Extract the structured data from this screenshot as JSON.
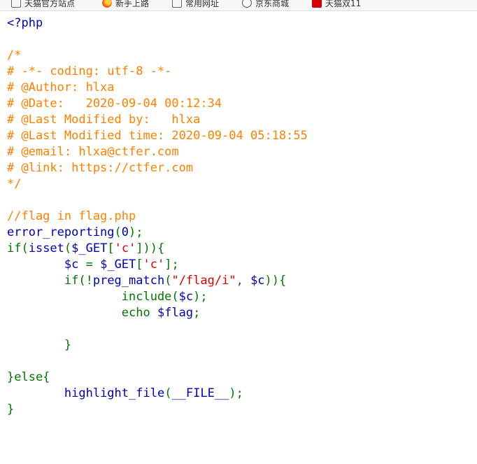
{
  "bookmarks": [
    {
      "icon": "folder-icon",
      "label": "天猫官方站点"
    },
    {
      "icon": "firefox-icon",
      "label": "新手上路"
    },
    {
      "icon": "folder-icon",
      "label": "常用网址"
    },
    {
      "icon": "globe-icon",
      "label": "京东商城"
    },
    {
      "icon": "tmall-icon",
      "label": "天猫双11"
    }
  ],
  "code": {
    "open_tag": "<?php",
    "comment_open": "/*",
    "comment_lines": [
      "# -*- coding: utf-8 -*-",
      "# @Author: hlxa",
      "# @Date:   2020-09-04 00:12:34",
      "# @Last Modified by:   hlxa",
      "# @Last Modified time: 2020-09-04 05:18:55",
      "# @email: hlxa@ctfer.com",
      "# @link: https://ctfer.com"
    ],
    "comment_close": "*/",
    "line_comment": "//flag in flag.php",
    "line_error_reporting": {
      "fn": "error_reporting",
      "open": "(",
      "arg": "0",
      "close": ");"
    },
    "line_if": {
      "kw": "if(",
      "fn": "isset",
      "open": "(",
      "var": "$_GET",
      "bopen": "[",
      "str": "'c'",
      "close": "])){"
    },
    "line_assign": {
      "var": "$c",
      "op": " = ",
      "src": "$_GET",
      "bopen": "[",
      "str": "'c'",
      "close": "];"
    },
    "line_if2": {
      "kw": "if(!",
      "fn": "preg_match",
      "open": "(",
      "str": "\"/flag/i\"",
      "sep": ", ",
      "var": "$c",
      "close": ")){"
    },
    "line_include": {
      "kw": "include(",
      "var": "$c",
      "close": ");"
    },
    "line_echo": {
      "kw": "echo ",
      "var": "$flag",
      "close": ";"
    },
    "brace_close": "}",
    "else": "}else{",
    "line_highlight": {
      "fn": "highlight_file",
      "open": "(",
      "arg": "__FILE__",
      "close": ");"
    },
    "final_close": "}"
  }
}
